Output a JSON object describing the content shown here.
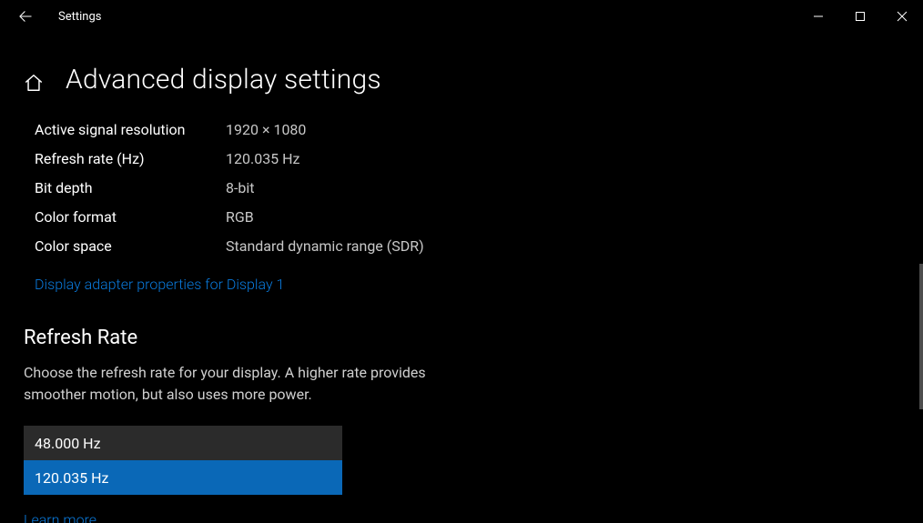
{
  "window": {
    "title": "Settings"
  },
  "page": {
    "title": "Advanced display settings"
  },
  "info": {
    "rows": [
      {
        "label": "Active signal resolution",
        "value": "1920 × 1080"
      },
      {
        "label": "Refresh rate (Hz)",
        "value": "120.035 Hz"
      },
      {
        "label": "Bit depth",
        "value": "8-bit"
      },
      {
        "label": "Color format",
        "value": "RGB"
      },
      {
        "label": "Color space",
        "value": "Standard dynamic range (SDR)"
      }
    ],
    "adapter_link": "Display adapter properties for Display 1"
  },
  "refresh": {
    "heading": "Refresh Rate",
    "description": "Choose the refresh rate for your display. A higher rate provides smoother motion, but also uses more power.",
    "options": [
      {
        "label": "48.000 Hz",
        "selected": false
      },
      {
        "label": "120.035 Hz",
        "selected": true
      }
    ],
    "learn_more": "Learn more"
  }
}
